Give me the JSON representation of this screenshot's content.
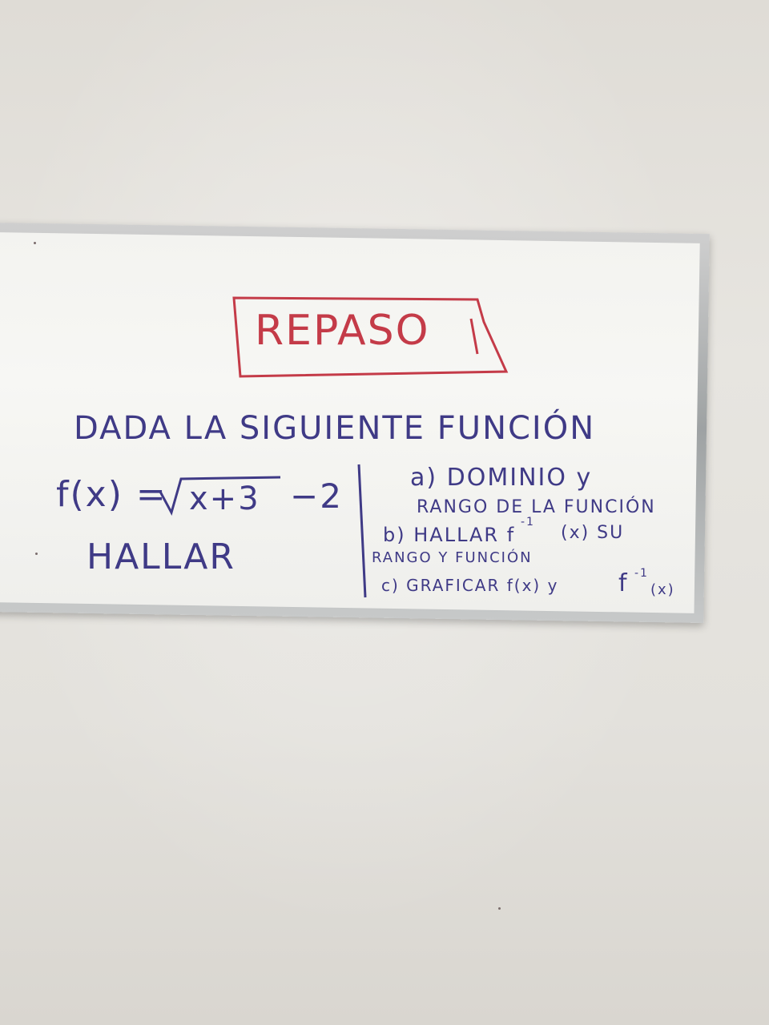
{
  "board": {
    "title": "REPASO",
    "intro": "DADA LA SIGUIENTE FUNCIÓN",
    "function": {
      "lhs": "f(x) =",
      "radicand": "x+3",
      "tail": "−2"
    },
    "hallar": "HALLAR",
    "items": {
      "a_line1": "a) DOMINIO y",
      "a_line2": "RANGO DE LA FUNCIÓN",
      "b_line1": "b) HALLAR f",
      "b_sup": "-1",
      "b_line1_end": "(x) SU",
      "b_line2": "RANGO Y FUNCIÓN",
      "c_line1": "c) GRAFICAR f(x) y",
      "c_f": "f",
      "c_sup": "-1",
      "c_end": "(x)"
    }
  },
  "colors": {
    "marker_blue": "#3f3a86",
    "marker_red": "#c43b48",
    "wall": "#e4e2dd",
    "frame": "#a9adae"
  }
}
